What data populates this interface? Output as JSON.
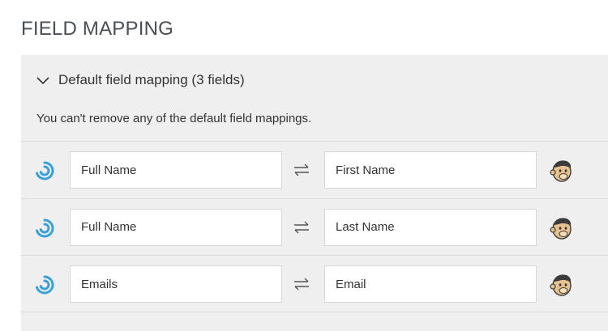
{
  "section": {
    "title": "FIELD MAPPING"
  },
  "accordion": {
    "title": "Default field mapping (3 fields)",
    "expanded": true,
    "note": "You can't remove any of the default field mappings."
  },
  "mappings": [
    {
      "source": "Full Name",
      "destination": "First Name"
    },
    {
      "source": "Full Name",
      "destination": "Last Name"
    },
    {
      "source": "Emails",
      "destination": "Email"
    }
  ],
  "icons": {
    "source": "source-app-logo-icon",
    "swap": "swap-arrows-icon",
    "destination": "mailchimp-logo-icon",
    "chevron": "chevron-down-icon"
  },
  "colors": {
    "panel_bg": "#efefef",
    "source_logo": "#3aa0d8",
    "title": "#4a4f55"
  }
}
